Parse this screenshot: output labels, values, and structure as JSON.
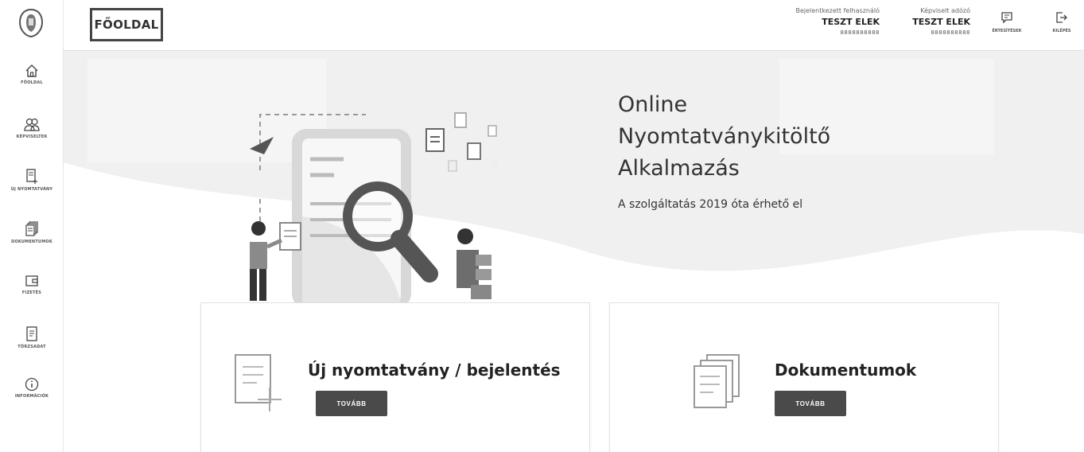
{
  "sidebar": {
    "logo_icon": "shield-coat-of-arms-icon",
    "items": [
      {
        "label": "FŐOLDAL",
        "icon": "home-icon"
      },
      {
        "label": "KÉPVISELTEK",
        "icon": "users-icon"
      },
      {
        "label": "ÚJ NYOMTATVÁNY",
        "icon": "new-form-icon"
      },
      {
        "label": "DOKUMENTUMOK",
        "icon": "documents-icon"
      },
      {
        "label": "FIZETÉS",
        "icon": "wallet-icon"
      },
      {
        "label": "TÖRZSADAT",
        "icon": "master-data-icon"
      },
      {
        "label": "INFORMÁCIÓK",
        "icon": "info-icon"
      }
    ]
  },
  "header": {
    "page_title": "FŐOLDAL",
    "logged_in_user": {
      "caption": "Bejelentkezett felhasználó",
      "name": "TESZT ELEK",
      "id": "8888888888"
    },
    "represented_taxpayer": {
      "caption": "Képviselt adózó",
      "name": "TESZT ELEK",
      "id": "8888888888"
    },
    "notifications": {
      "label": "ÉRTESÍTÉSEK",
      "icon": "chat-bubble-icon"
    },
    "logout": {
      "label": "KILÉPÉS",
      "icon": "logout-icon"
    }
  },
  "hero": {
    "title_lines": [
      "Online",
      "Nyomtatványkitöltő",
      "Alkalmazás"
    ],
    "subtitle": "A szolgáltatás 2019 óta érhető el"
  },
  "cards": [
    {
      "title": "Új nyomtatvány / bejelentés",
      "button_label": "TOVÁBB",
      "icon": "new-form-icon"
    },
    {
      "title": "Dokumentumok",
      "button_label": "TOVÁBB",
      "icon": "documents-stack-icon"
    }
  ],
  "colors": {
    "button_bg": "#4a4a4a",
    "hero_band": "#efefef",
    "accent_orange_gray": "#9a9a9a"
  }
}
